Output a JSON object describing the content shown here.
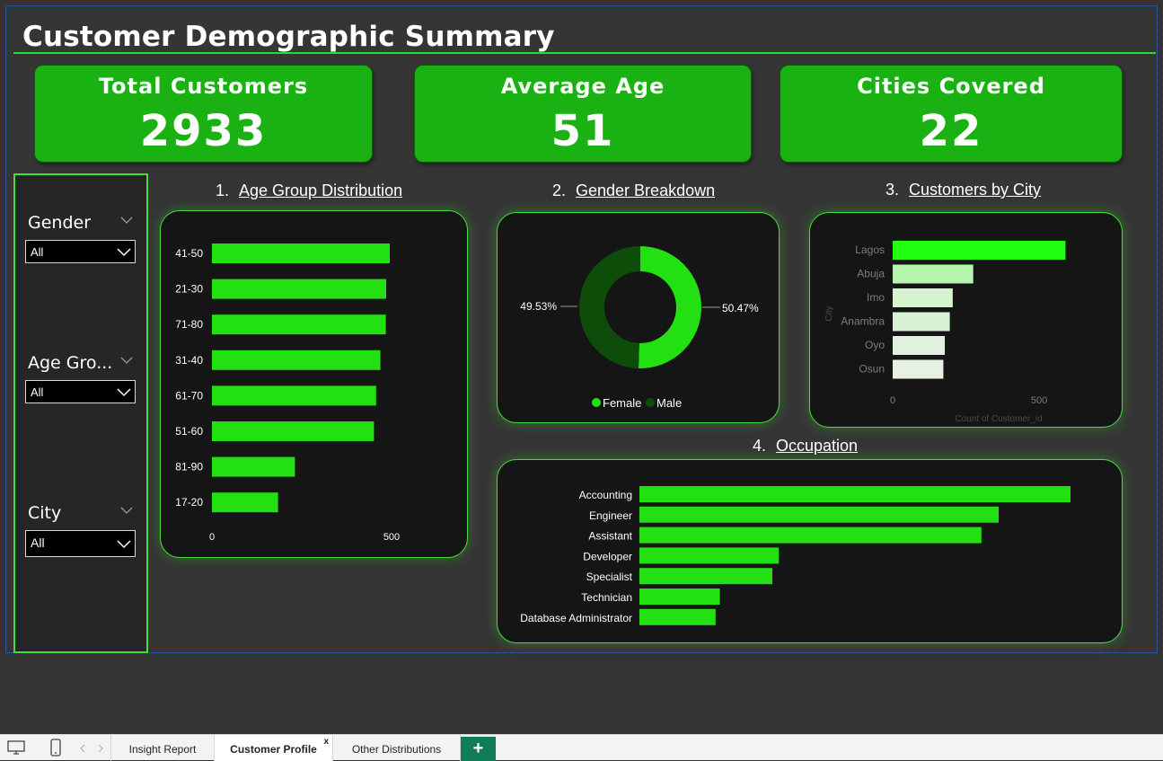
{
  "page": {
    "title": "Customer Demographic Summary"
  },
  "kpis": [
    {
      "label": "Total Customers",
      "value": "2933"
    },
    {
      "label": "Average Age",
      "value": "51"
    },
    {
      "label": "Cities Covered",
      "value": "22"
    }
  ],
  "slicers": [
    {
      "label": "Gender",
      "value": "All"
    },
    {
      "label": "Age Gro...",
      "value": "All"
    },
    {
      "label": "City",
      "value": "All"
    }
  ],
  "charts": [
    {
      "number": "1.",
      "title": "Age Group Distribution"
    },
    {
      "number": "2.",
      "title": "Gender Breakdown"
    },
    {
      "number": "3.",
      "title": "Customers by City"
    },
    {
      "number": "4.",
      "title": "Occupation"
    }
  ],
  "chart_data": [
    {
      "type": "bar",
      "orientation": "horizontal",
      "title": "Age Group Distribution",
      "categories": [
        "41-50",
        "21-30",
        "71-80",
        "31-40",
        "61-70",
        "51-60",
        "81-90",
        "17-20"
      ],
      "values": [
        495,
        485,
        484,
        469,
        457,
        451,
        231,
        184
      ],
      "xticks": [
        "0",
        "500"
      ],
      "xlim": [
        0,
        550
      ],
      "color": "#22e012"
    },
    {
      "type": "pie",
      "donut": true,
      "title": "Gender Breakdown",
      "categories": [
        "Female",
        "Male"
      ],
      "values": [
        50.47,
        49.53
      ],
      "labels": [
        "50.47%",
        "49.53%"
      ],
      "colors": [
        "#22e012",
        "#0e4d09"
      ],
      "legend": "bottom"
    },
    {
      "type": "bar",
      "orientation": "horizontal",
      "title": "Customers by City",
      "categories": [
        "Lagos",
        "Abuja",
        "Imo",
        "Anambra",
        "Oyo",
        "Osun"
      ],
      "values": [
        590,
        275,
        205,
        195,
        178,
        173
      ],
      "xticks": [
        "0",
        "500"
      ],
      "xlim": [
        0,
        650
      ],
      "xlabel": "Count of Customer_id",
      "ylabel": "City",
      "colors": [
        "#22ff12",
        "#b6f5ae",
        "#d6f4d0",
        "#d8f3d3",
        "#e0f2dd",
        "#e6f1e4"
      ]
    },
    {
      "type": "bar",
      "orientation": "horizontal",
      "title": "Occupation",
      "categories": [
        "Accounting",
        "Engineer",
        "Assistant",
        "Developer",
        "Specialist",
        "Technician",
        "Database Administrator"
      ],
      "values": [
        600,
        500,
        476,
        194,
        185,
        112,
        106
      ],
      "xlim": [
        0,
        650
      ],
      "color": "#22e012"
    }
  ],
  "tabs": {
    "items": [
      {
        "label": "Insight Report"
      },
      {
        "label": "Customer Profile"
      },
      {
        "label": "Other Distributions"
      }
    ],
    "close_glyph": "x",
    "add_glyph": "+"
  }
}
